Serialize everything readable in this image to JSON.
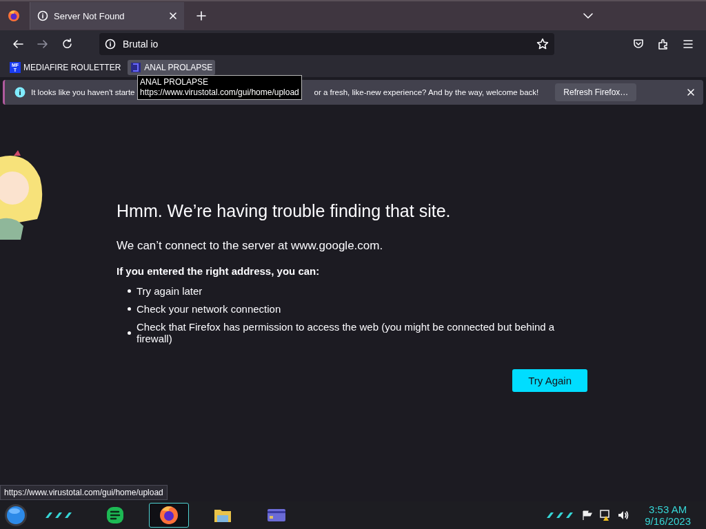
{
  "tabs": [
    {
      "title": "Server Not Found",
      "selected": true
    }
  ],
  "address_bar": {
    "value": "Brutal io"
  },
  "bookmarks": [
    {
      "label": "MEDIAFIRE ROULETTER",
      "kind": "letters",
      "icon_top": "MF",
      "icon_bottom": "T",
      "hovered": false
    },
    {
      "label": "ANAL PROLAPSE",
      "kind": "bracket",
      "hovered": true
    }
  ],
  "tooltip": {
    "title": "ANAL PROLAPSE",
    "url": "https://www.virustotal.com/gui/home/upload"
  },
  "notification": {
    "text_before": "It looks like you haven't starte",
    "text_after": "or a fresh, like-new experience? And by the way, welcome back!",
    "button": "Refresh Firefox…"
  },
  "error_page": {
    "title": "Hmm. We’re having trouble finding that site.",
    "subtitle": "We can’t connect to the server at www.google.com.",
    "lead": "If you entered the right address, you can:",
    "items": [
      "Try again later",
      "Check your network connection",
      "Check that Firefox has permission to access the web (you might be connected but behind a firewall)"
    ],
    "button": "Try Again"
  },
  "status_url": "https://www.virustotal.com/gui/home/upload",
  "taskbar": {
    "apps": [
      {
        "kind": "chat",
        "active": false
      },
      {
        "kind": "browser",
        "active": true
      },
      {
        "kind": "folder",
        "active": false
      },
      {
        "kind": "card",
        "active": false
      }
    ],
    "time": "3:53 AM",
    "date": "9/16/2023"
  }
}
